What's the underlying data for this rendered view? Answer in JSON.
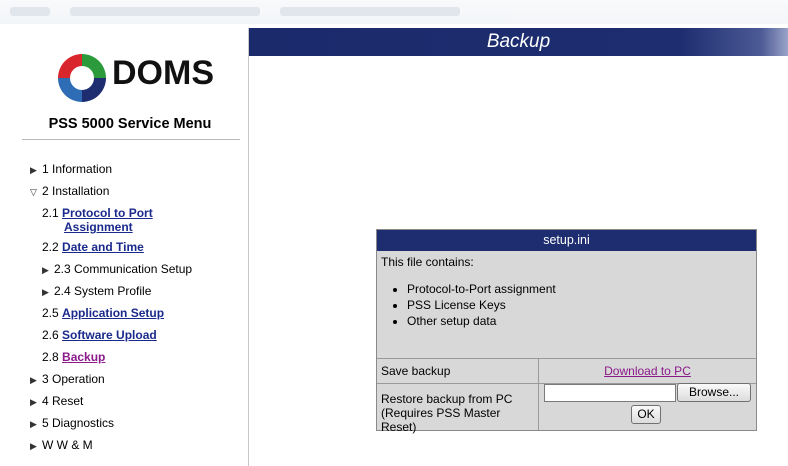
{
  "brand": {
    "logo_text": "DOMS"
  },
  "sidebar": {
    "title": "PSS 5000 Service Menu",
    "items": [
      {
        "label": "1 Information"
      },
      {
        "label": "2 Installation"
      },
      {
        "num": "2.1",
        "link": "Protocol to Port",
        "link2": "Assignment"
      },
      {
        "num": "2.2",
        "link": "Date and Time"
      },
      {
        "label": "2.3 Communication Setup"
      },
      {
        "label": "2.4 System Profile"
      },
      {
        "num": "2.5",
        "link": "Application Setup"
      },
      {
        "num": "2.6",
        "link": "Software Upload"
      },
      {
        "num": "2.8",
        "link": "Backup"
      },
      {
        "label": "3 Operation"
      },
      {
        "label": "4 Reset"
      },
      {
        "label": "5 Diagnostics"
      },
      {
        "label": "W W & M"
      }
    ]
  },
  "page": {
    "title": "Backup"
  },
  "panel": {
    "header": "setup.ini",
    "intro": "This file contains:",
    "bullets": [
      "Protocol-to-Port assignment",
      "PSS License Keys",
      "Other setup data"
    ],
    "save_label": "Save backup",
    "download_link": "Download to PC",
    "restore_line1": "Restore backup from PC",
    "restore_line2": "(Requires PSS Master Reset)",
    "browse_label": "Browse...",
    "ok_label": "OK"
  },
  "colors": {
    "header_bg": "#1d2d6f",
    "link": "#1a2a8c",
    "visited_link": "#8a1a8a",
    "panel_bg": "#d8d8d8"
  }
}
